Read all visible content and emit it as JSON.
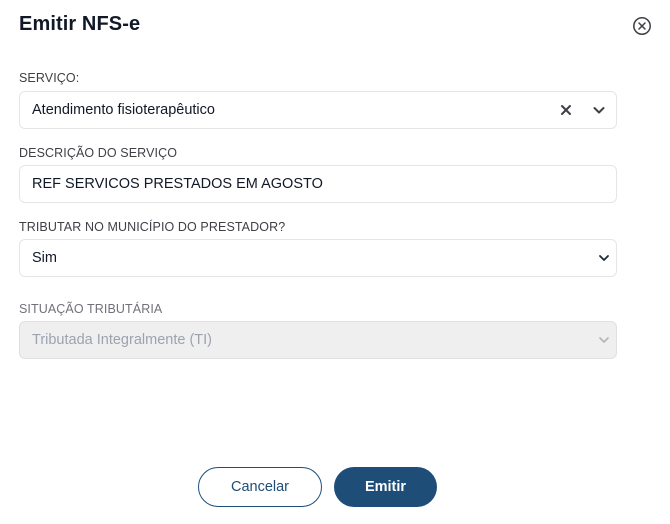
{
  "dialog": {
    "title": "Emitir NFS-e"
  },
  "fields": {
    "servico": {
      "label": "SERVIÇO:",
      "value": "Atendimento fisioterapêutico"
    },
    "descricao": {
      "label": "DESCRIÇÃO DO SERVIÇO",
      "value": "REF SERVICOS PRESTADOS EM AGOSTO"
    },
    "tributar": {
      "label": "TRIBUTAR NO MUNICÍPIO DO PRESTADOR?",
      "value": "Sim"
    },
    "situacao": {
      "label": "SITUAÇÃO TRIBUTÁRIA",
      "value": "Tributada Integralmente (TI)"
    }
  },
  "actions": {
    "cancel_label": "Cancelar",
    "submit_label": "Emitir"
  },
  "icons": {
    "close": "close-circle-icon",
    "clear": "x-icon",
    "dropdown": "chevron-down-icon"
  },
  "colors": {
    "primary": "#1e4d78",
    "disabled_bg": "#efefef",
    "border": "#e3e5e8"
  }
}
